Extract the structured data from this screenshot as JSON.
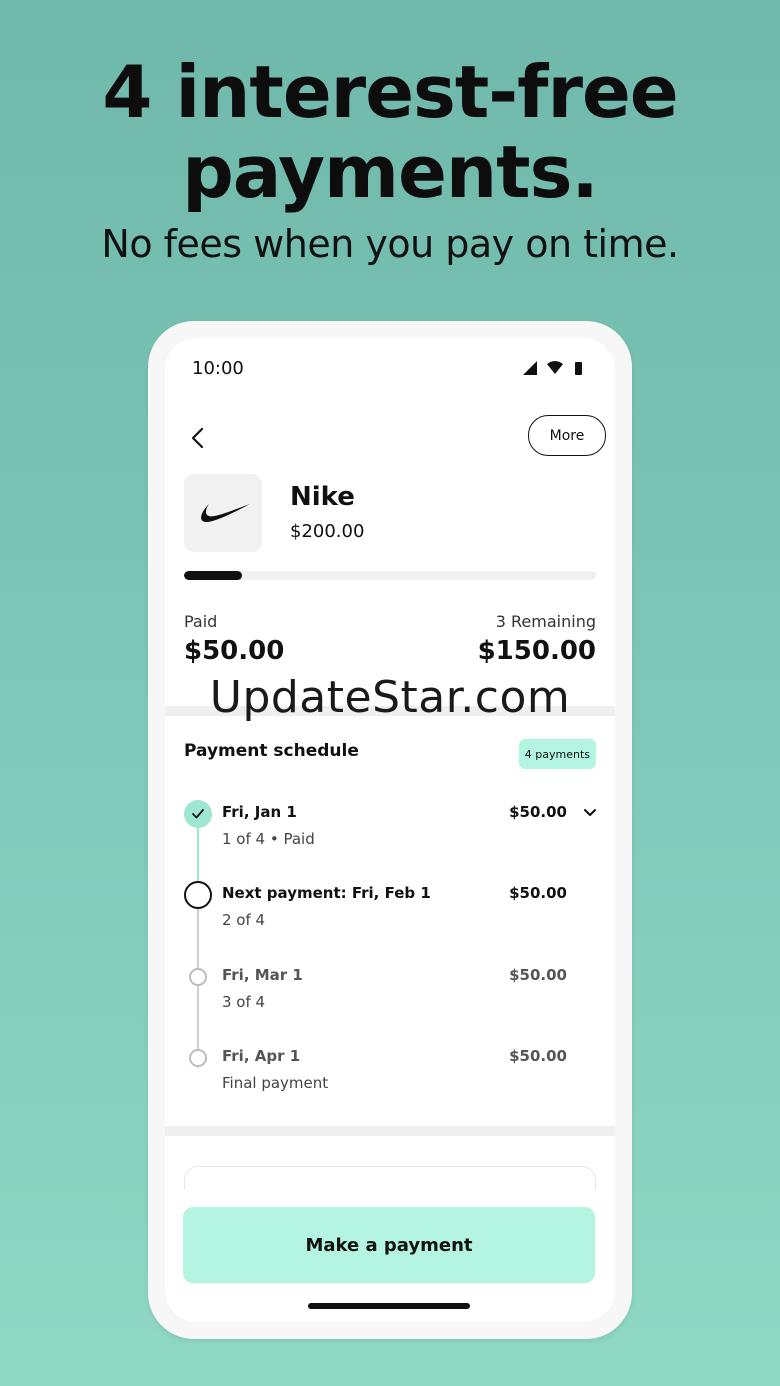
{
  "promo": {
    "headline_line1": "4 interest-free",
    "headline_line2": "payments.",
    "subhead": "No fees when you pay on time."
  },
  "status_bar": {
    "time": "10:00",
    "icons": [
      "signal-icon",
      "wifi-icon",
      "battery-icon"
    ]
  },
  "header": {
    "back_icon": "chevron-left-icon",
    "more_label": "More"
  },
  "merchant": {
    "logo_icon": "nike-swoosh-icon",
    "name": "Nike",
    "amount": "$200.00"
  },
  "progress": {
    "fraction": 0.14
  },
  "summary": {
    "paid_label": "Paid",
    "paid_value": "$50.00",
    "remaining_label": "3 Remaining",
    "remaining_value": "$150.00"
  },
  "schedule": {
    "title": "Payment schedule",
    "badge": "4 payments",
    "items": [
      {
        "title": "Fri, Jan 1",
        "subtitle": "1 of 4 • Paid",
        "amount": "$50.00",
        "state": "paid"
      },
      {
        "title": "Next payment: Fri, Feb 1",
        "subtitle": "2 of 4",
        "amount": "$50.00",
        "state": "next"
      },
      {
        "title": "Fri, Mar 1",
        "subtitle": "3 of 4",
        "amount": "$50.00",
        "state": "upcoming"
      },
      {
        "title": "Fri, Apr 1",
        "subtitle": "Final payment",
        "amount": "$50.00",
        "state": "upcoming"
      }
    ]
  },
  "action": {
    "make_payment_label": "Make a payment"
  },
  "watermark": "UpdateStar.com",
  "colors": {
    "accent_mint": "#b3f5e0",
    "check_mint": "#9ee8d3",
    "background_teal": "#7cc6b6",
    "text_dark": "#111111"
  }
}
